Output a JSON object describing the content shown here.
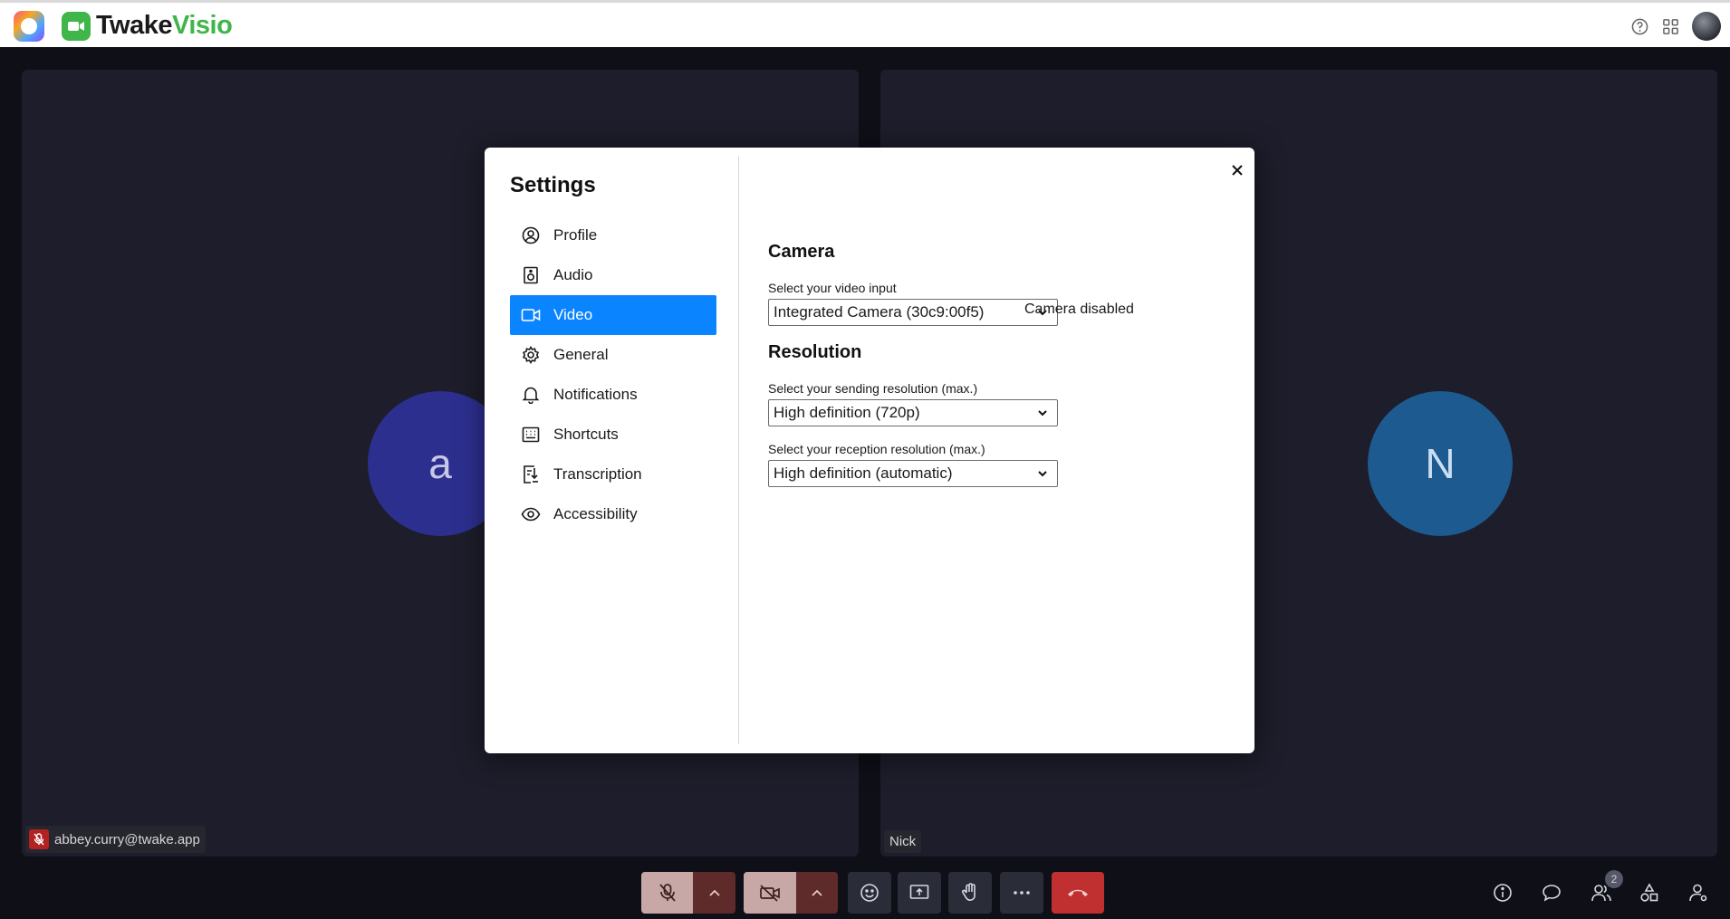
{
  "brand": {
    "name_part1": "Twake",
    "name_part2": "Visio"
  },
  "participants": {
    "left": {
      "initial": "a",
      "name": "abbey.curry@twake.app"
    },
    "right": {
      "initial": "N",
      "name": "Nick"
    }
  },
  "participant_count": "2",
  "settings": {
    "title": "Settings",
    "nav": [
      {
        "label": "Profile",
        "icon": "user-circle-icon"
      },
      {
        "label": "Audio",
        "icon": "speaker-icon"
      },
      {
        "label": "Video",
        "icon": "video-camera-icon",
        "active": true
      },
      {
        "label": "General",
        "icon": "gear-icon"
      },
      {
        "label": "Notifications",
        "icon": "bell-icon"
      },
      {
        "label": "Shortcuts",
        "icon": "keyboard-icon"
      },
      {
        "label": "Transcription",
        "icon": "transcript-icon"
      },
      {
        "label": "Accessibility",
        "icon": "eye-icon"
      }
    ],
    "camera": {
      "heading": "Camera",
      "input_label": "Select your video input",
      "input_value": "Integrated Camera (30c9:00f5)",
      "status": "Camera disabled"
    },
    "resolution": {
      "heading": "Resolution",
      "sending_label": "Select your sending resolution (max.)",
      "sending_value": "High definition (720p)",
      "reception_label": "Select your reception resolution (max.)",
      "reception_value": "High definition (automatic)"
    }
  },
  "colors": {
    "accent": "#0a84ff",
    "brand_green": "#3fb54a",
    "hangup": "#c03030",
    "muted_control": "#c8a7a7"
  }
}
